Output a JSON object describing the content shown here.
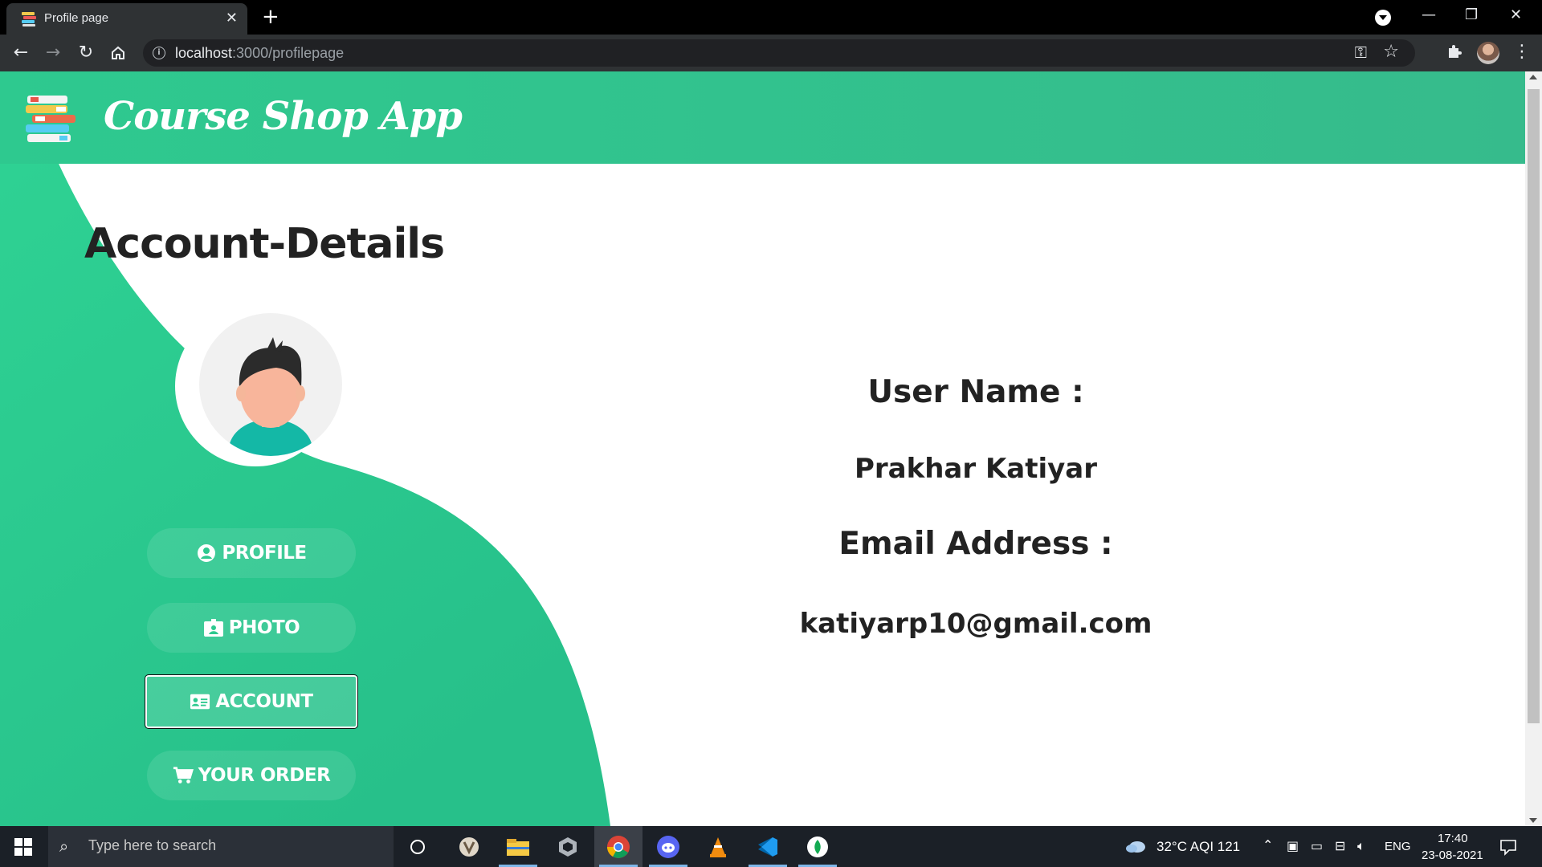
{
  "browser": {
    "tab_title": "Profile page",
    "tab_close": "✕",
    "new_tab": "+",
    "url_host": "localhost",
    "url_rest": ":3000/profilepage",
    "win_minimize": "—",
    "win_restore": "❐",
    "win_close": "✕",
    "icons": [
      "back-icon",
      "forward-icon",
      "reload-icon",
      "home-icon",
      "info-icon",
      "key-icon",
      "star-icon",
      "extensions-icon",
      "menu-dots-icon"
    ]
  },
  "app": {
    "brand": "Course Shop App",
    "heading": "Account-Details",
    "colors": {
      "accent": "#2ecf94",
      "navbar": "#33c08d",
      "text": "#222222"
    },
    "sidebar": [
      {
        "id": "profile",
        "label": "PROFILE",
        "icon": "user-circle-icon",
        "active": false
      },
      {
        "id": "photo",
        "label": "PHOTO",
        "icon": "id-badge-icon",
        "active": false
      },
      {
        "id": "account",
        "label": "ACCOUNT",
        "icon": "id-card-icon",
        "active": true
      },
      {
        "id": "order",
        "label": "YOUR ORDER",
        "icon": "cart-icon",
        "active": false
      }
    ],
    "details": {
      "username_label": "User Name :",
      "username_value": "Prakhar Katiyar",
      "email_label": "Email Address :",
      "email_value": "katiyarp10@gmail.com"
    }
  },
  "taskbar": {
    "search_placeholder": "Type here to search",
    "weather": "32°C  AQI 121",
    "language": "ENG",
    "time": "17:40",
    "date": "23-08-2021",
    "apps": [
      "task-view-icon",
      "app-icon",
      "file-explorer-icon",
      "unity-icon",
      "chrome-icon",
      "discord-icon",
      "vlc-icon",
      "vscode-icon",
      "mongodb-icon"
    ]
  }
}
